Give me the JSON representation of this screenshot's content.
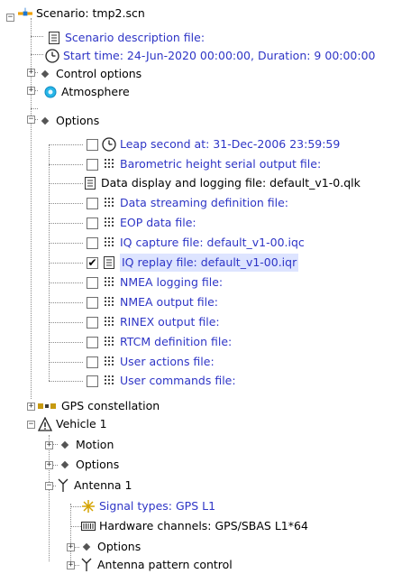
{
  "tree": {
    "root": {
      "label": "Scenario: tmp2.scn",
      "icon": "scenario-satellite-icon"
    },
    "scenario_description": "Scenario description file:",
    "start_time": "Start time: 24-Jun-2020 00:00:00, Duration: 9 00:00:00",
    "control_options": "Control options",
    "atmosphere": "Atmosphere",
    "options": {
      "label": "Options",
      "children": [
        {
          "label": "Leap second at: 31-Dec-2006 23:59:59",
          "checked": false,
          "icon": "clock-icon",
          "has_checkbox": true
        },
        {
          "label": "Barometric height serial output file:",
          "checked": false,
          "icon": "grid-file-icon",
          "has_checkbox": true
        },
        {
          "label": "Data display and logging file: default_v1-0.qlk",
          "checked": null,
          "icon": "document-icon",
          "has_checkbox": false
        },
        {
          "label": "Data streaming definition file:",
          "checked": false,
          "icon": "grid-file-icon",
          "has_checkbox": true
        },
        {
          "label": "EOP data file:",
          "checked": false,
          "icon": "grid-file-icon",
          "has_checkbox": true
        },
        {
          "label": "IQ capture file: default_v1-00.iqc",
          "checked": false,
          "icon": "grid-file-icon",
          "has_checkbox": true
        },
        {
          "label": "IQ replay file: default_v1-00.iqr",
          "checked": true,
          "icon": "document-icon",
          "has_checkbox": true
        },
        {
          "label": "NMEA logging file:",
          "checked": false,
          "icon": "grid-file-icon",
          "has_checkbox": true
        },
        {
          "label": "NMEA output file:",
          "checked": false,
          "icon": "grid-file-icon",
          "has_checkbox": true
        },
        {
          "label": "RINEX output file:",
          "checked": false,
          "icon": "grid-file-icon",
          "has_checkbox": true
        },
        {
          "label": "RTCM definition file:",
          "checked": false,
          "icon": "grid-file-icon",
          "has_checkbox": true
        },
        {
          "label": "User actions file:",
          "checked": false,
          "icon": "grid-file-icon",
          "has_checkbox": true
        },
        {
          "label": "User commands file:",
          "checked": false,
          "icon": "grid-file-icon",
          "has_checkbox": true
        }
      ]
    },
    "gps_constellation": "GPS constellation",
    "vehicle": {
      "label": "Vehicle 1",
      "motion": "Motion",
      "options": "Options",
      "antenna": {
        "label": "Antenna  1",
        "signal_types": "Signal types: GPS L1",
        "hardware_channels": "Hardware channels: GPS/SBAS L1*64",
        "options": "Options",
        "pattern_control": "Antenna pattern control"
      }
    }
  },
  "colors": {
    "link_blue": "#2e35c6",
    "selection_bg": "#dde4ff",
    "atmosphere_cyan": "#27b6e8",
    "constellation_gold": "#c79a10"
  }
}
